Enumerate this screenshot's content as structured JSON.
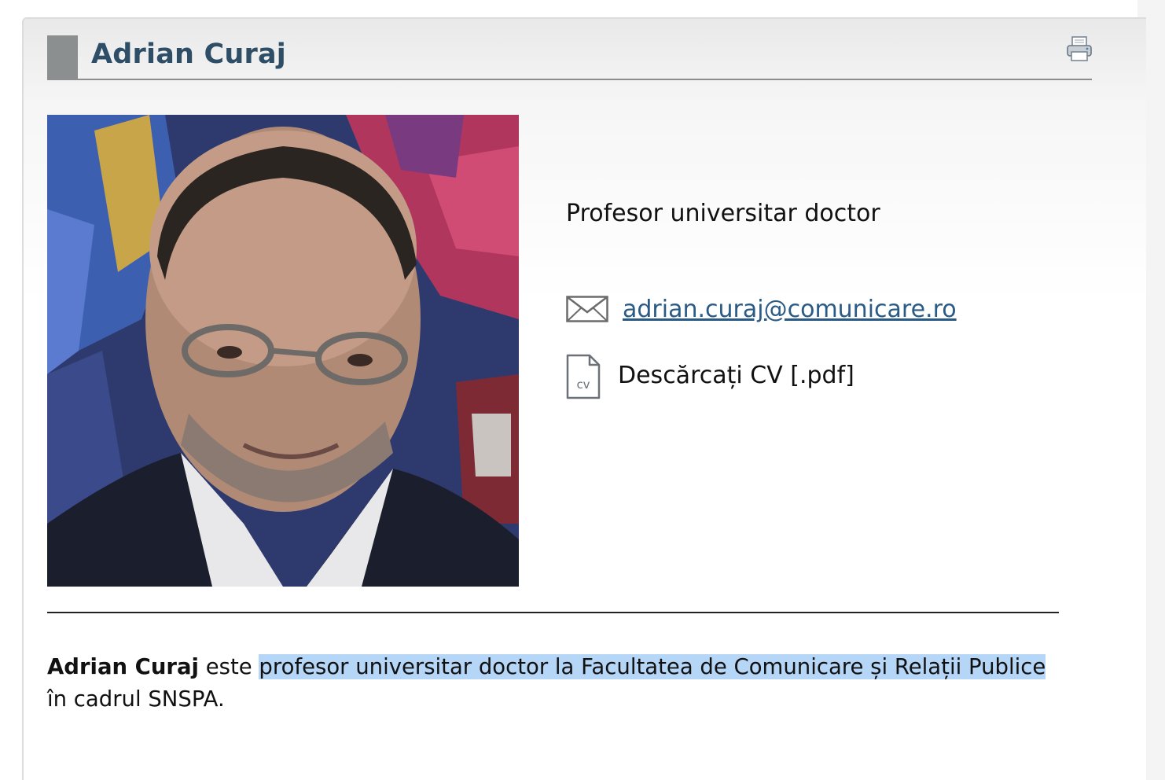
{
  "profile": {
    "name": "Adrian Curaj",
    "role": "Profesor universitar doctor",
    "email": "adrian.curaj@comunicare.ro",
    "cv_label": "Descărcați CV [.pdf]",
    "cv_icon_text": "cv"
  },
  "bio": {
    "name": "Adrian Curaj",
    "pre": " este ",
    "highlighted": "profesor universitar doctor la Facultatea de Comunicare și Relații Publice",
    "post": " în cadrul SNSPA."
  },
  "icons": {
    "print": "printer-icon",
    "email": "envelope-icon",
    "cv": "pdf-document-icon"
  },
  "colors": {
    "title": "#2d4e66",
    "link": "#2a5a86",
    "selection_highlight": "#b6d6f7",
    "accent_block": "#8c8f8f"
  }
}
